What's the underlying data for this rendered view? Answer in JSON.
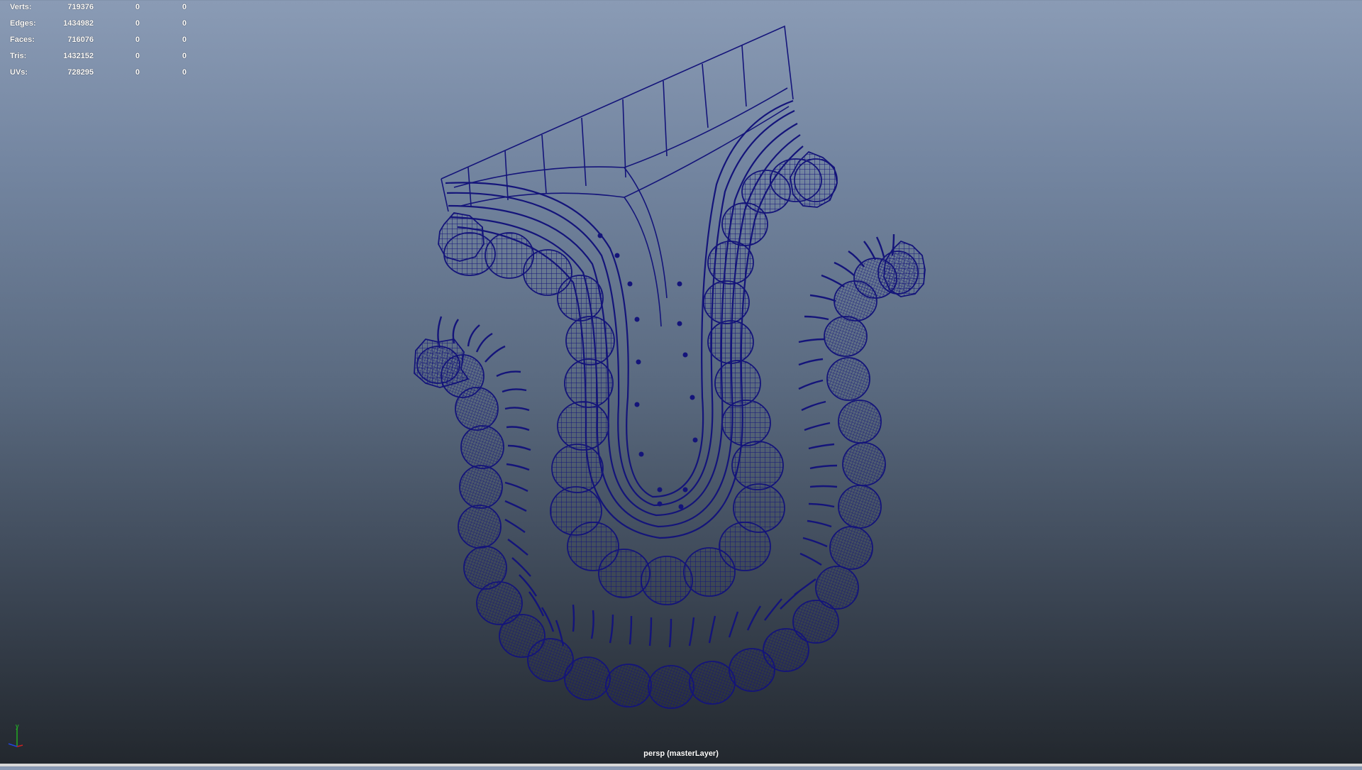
{
  "hud": {
    "rows": [
      {
        "label": "Verts:",
        "v1": "719376",
        "v2": "0",
        "v3": "0"
      },
      {
        "label": "Edges:",
        "v1": "1434982",
        "v2": "0",
        "v3": "0"
      },
      {
        "label": "Faces:",
        "v1": "716076",
        "v2": "0",
        "v3": "0"
      },
      {
        "label": "Tris:",
        "v1": "1432152",
        "v2": "0",
        "v3": "0"
      },
      {
        "label": "UVs:",
        "v1": "728295",
        "v2": "0",
        "v3": "0"
      }
    ]
  },
  "camera_label": "persp (masterLayer)",
  "axis": {
    "y_label": "y"
  },
  "colors": {
    "wireframe": "#14147a",
    "axis_x": "#cc2222",
    "axis_y": "#22aa22",
    "axis_z": "#2244dd"
  }
}
